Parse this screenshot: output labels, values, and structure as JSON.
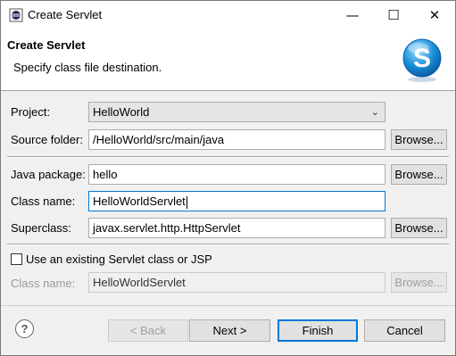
{
  "window": {
    "title": "Create Servlet",
    "minimize_glyph": "—",
    "maximize_glyph": "☐",
    "close_glyph": "✕"
  },
  "header": {
    "title": "Create Servlet",
    "message": "Specify class file destination.",
    "logo_letter": "S"
  },
  "form": {
    "project_label": "Project:",
    "project_value": "HelloWorld",
    "source_folder_label": "Source folder:",
    "source_folder_value": "/HelloWorld/src/main/java",
    "java_package_label": "Java package:",
    "java_package_value": "hello",
    "class_name_label": "Class name:",
    "class_name_value": "HelloWorldServlet",
    "superclass_label": "Superclass:",
    "superclass_value": "javax.servlet.http.HttpServlet",
    "browse_label": "Browse...",
    "use_existing_label": "Use an existing Servlet class or JSP",
    "use_existing_checked": false,
    "existing_class_label": "Class name:",
    "existing_class_value": "HelloWorldServlet"
  },
  "footer": {
    "help_glyph": "?",
    "back_label": "< Back",
    "next_label": "Next >",
    "finish_label": "Finish",
    "cancel_label": "Cancel"
  },
  "colors": {
    "accent": "#0078d7",
    "logo_blue": "#1a8fd8"
  }
}
